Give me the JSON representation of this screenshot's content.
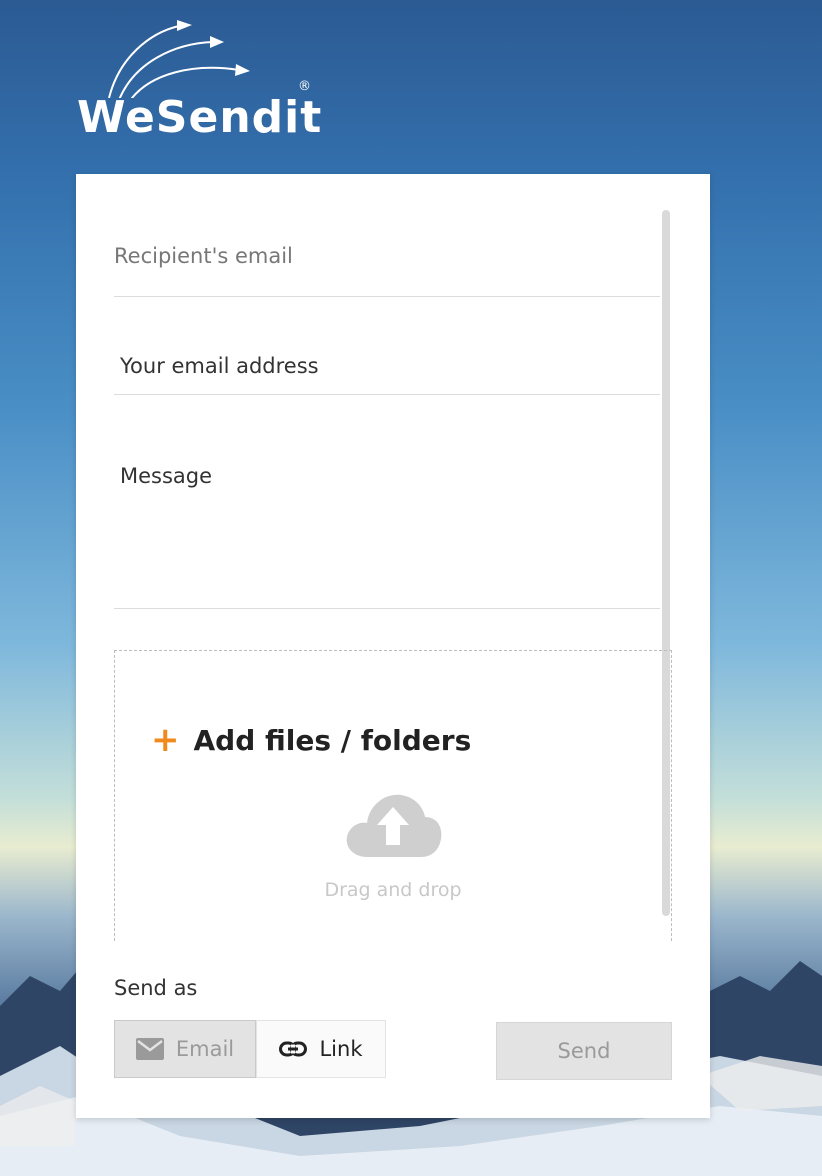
{
  "brand": {
    "name": "WeSendit",
    "registered_mark": "®"
  },
  "form": {
    "recipient_placeholder": "Recipient's email",
    "sender_placeholder": "Your email address",
    "message_placeholder": "Message"
  },
  "upload": {
    "add_label": "Add files / folders",
    "drag_label": "Drag and drop",
    "plus_symbol": "+",
    "icons": [
      "plus-icon",
      "cloud-upload-icon"
    ]
  },
  "send_options": {
    "label": "Send as",
    "email_label": "Email",
    "link_label": "Link",
    "selected": "Email",
    "icons": [
      "envelope-icon",
      "link-icon"
    ]
  },
  "actions": {
    "send_label": "Send"
  },
  "colors": {
    "accent": "#f08a1c",
    "card": "#ffffff",
    "disabled_button": "#e3e3e3"
  }
}
